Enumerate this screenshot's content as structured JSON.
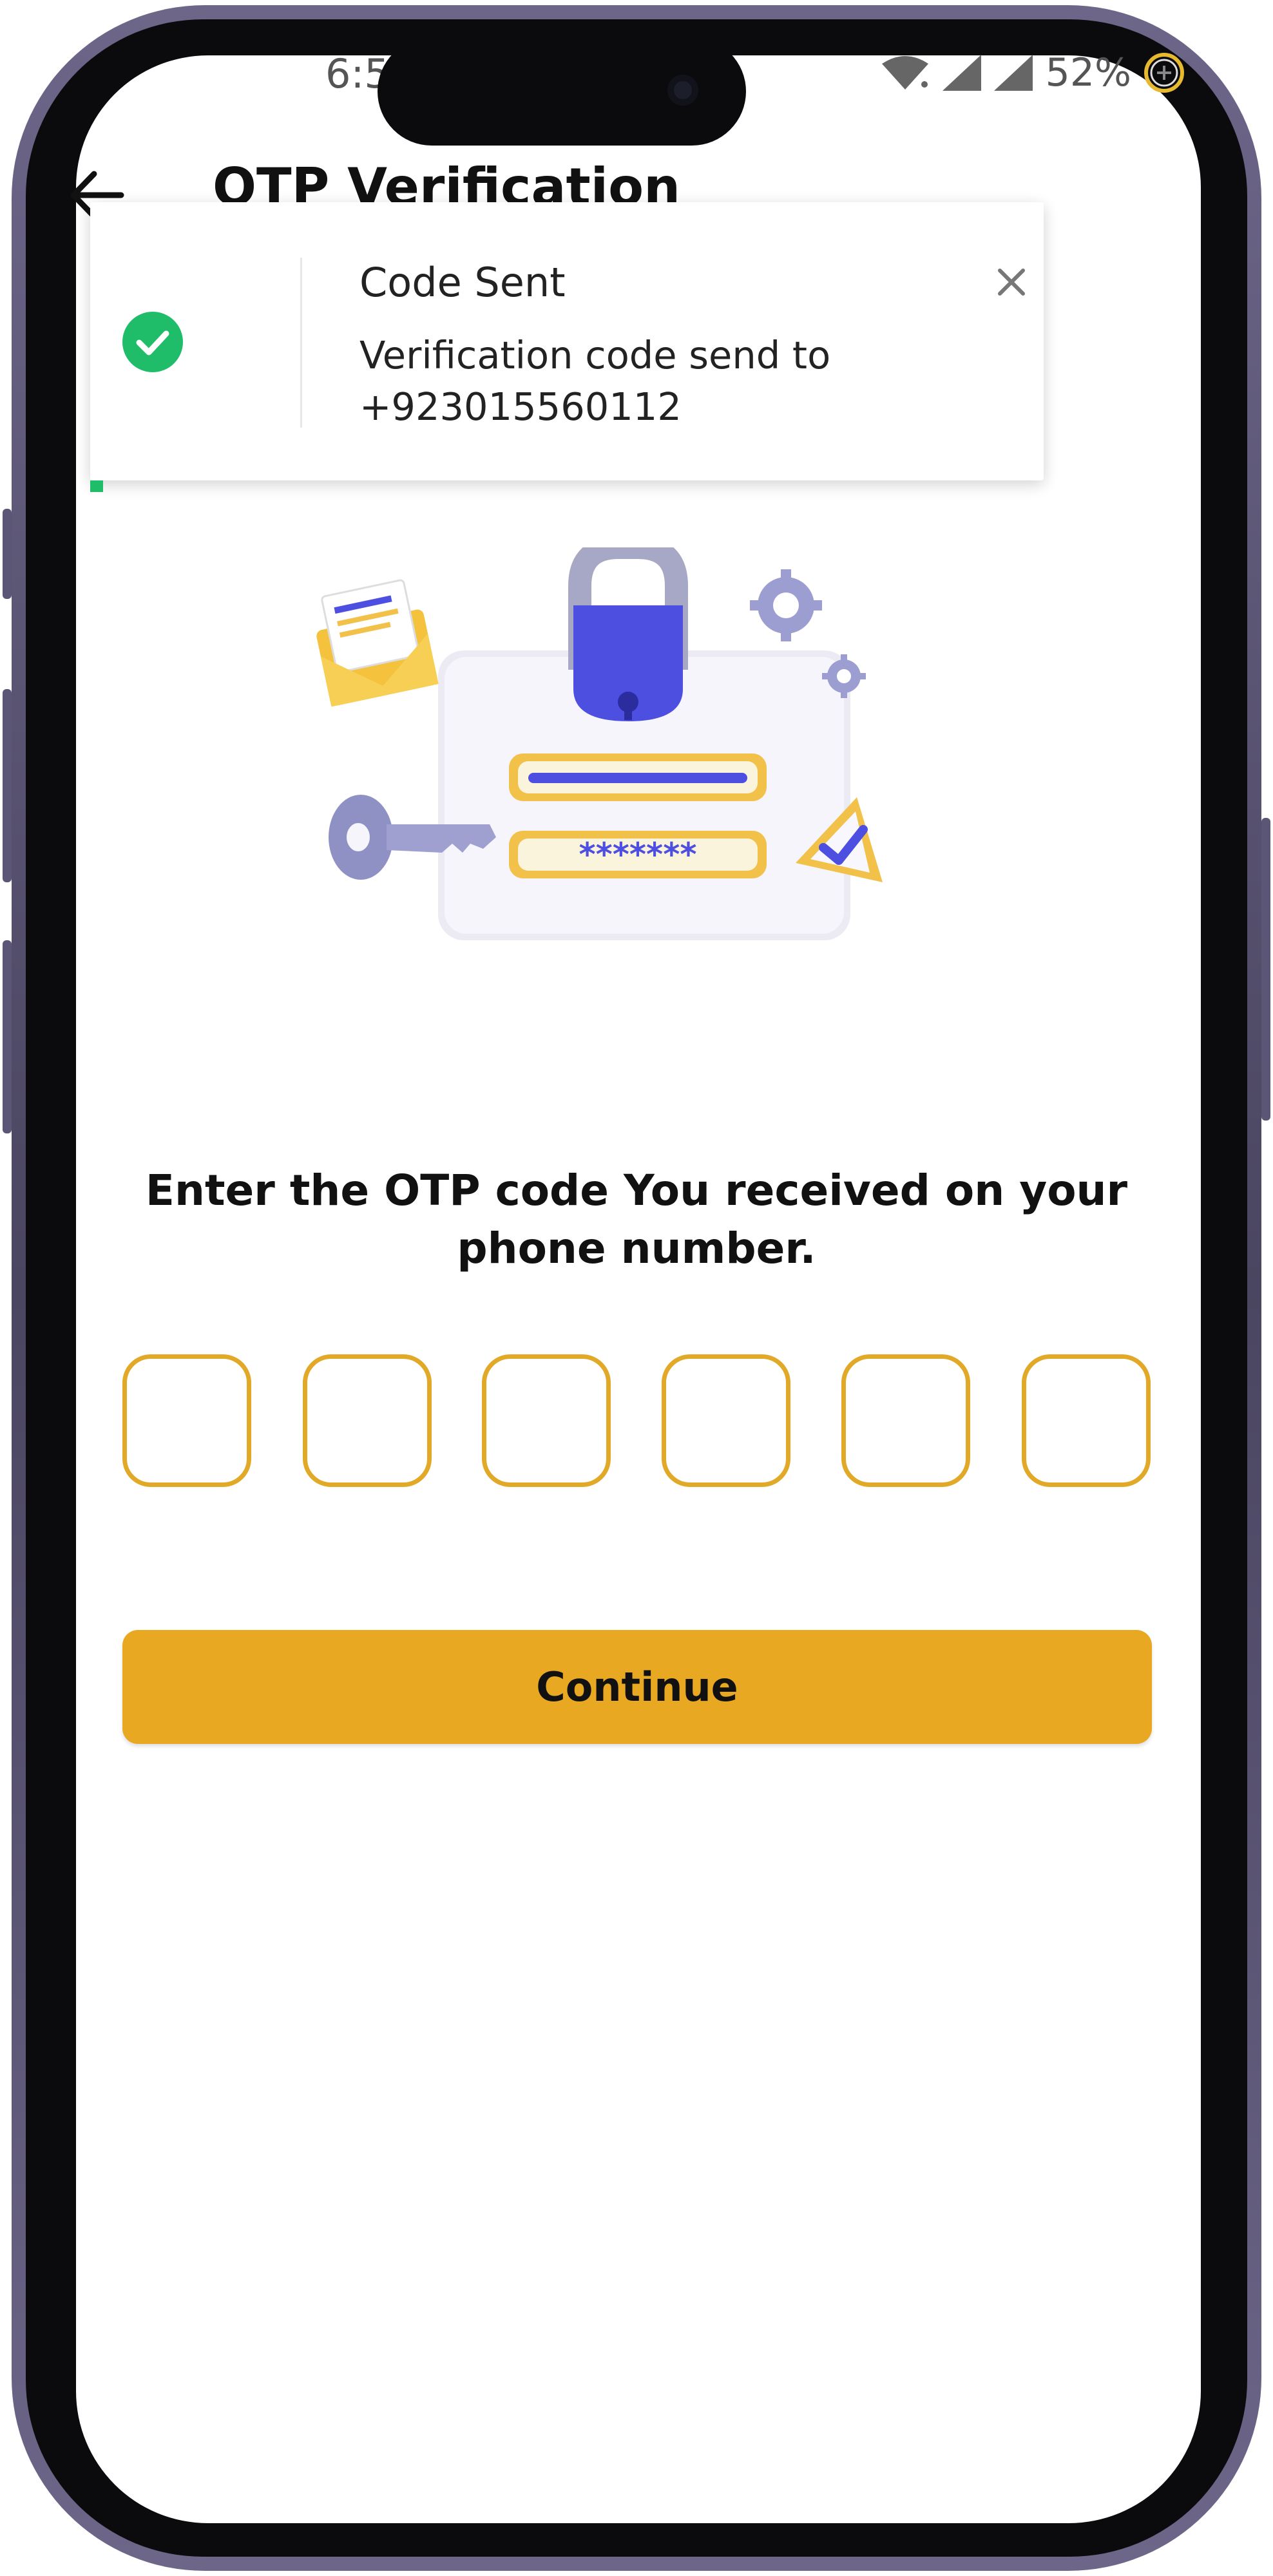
{
  "status_bar": {
    "time": "6:5",
    "battery": "52%"
  },
  "header": {
    "title": "OTP Verification"
  },
  "toast": {
    "title": "Code Sent",
    "message_line1": "Verification code send to",
    "message_line2": "+923015560112",
    "accent_color": "#1fbd6a"
  },
  "prompt": {
    "text": "Enter the OTP code You received on your phone number."
  },
  "otp": {
    "digits": [
      "",
      "",
      "",
      "",
      "",
      ""
    ],
    "border_color": "#e2a928"
  },
  "actions": {
    "continue_label": "Continue",
    "button_color": "#e8a821"
  },
  "icons": [
    "arrow-left-icon",
    "check-circle-icon",
    "close-icon",
    "wifi-icon",
    "signal-icon",
    "battery-icon"
  ]
}
